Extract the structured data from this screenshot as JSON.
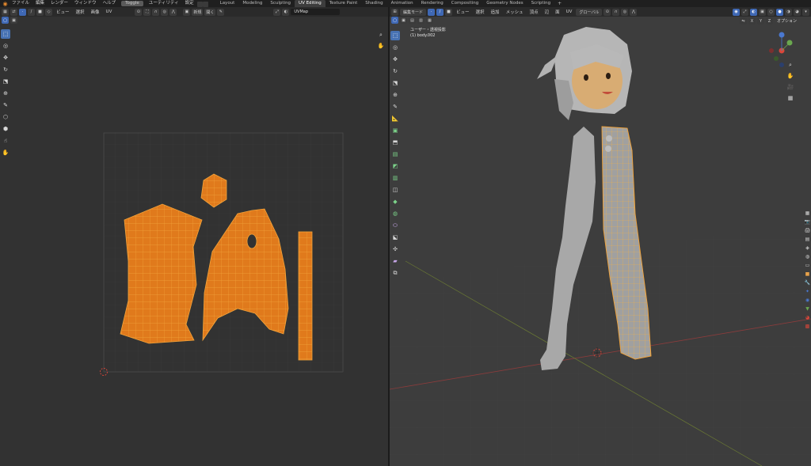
{
  "topbar": {
    "menus": [
      "ファイル",
      "編集",
      "レンダー",
      "ウィンドウ",
      "ヘルプ"
    ],
    "toggle_label": "Toggle",
    "menus2": [
      "ユーティリティ",
      "設定"
    ],
    "workspaces": [
      "Layout",
      "Modeling",
      "Sculpting",
      "UV Editing",
      "Texture Paint",
      "Shading",
      "Animation",
      "Rendering",
      "Compositing",
      "Geometry Nodes",
      "Scripting"
    ],
    "active_workspace": "UV Editing",
    "add_tab": "+"
  },
  "uv_editor": {
    "header_menus": [
      "ビュー",
      "選択",
      "画像",
      "UV"
    ],
    "new_label": "新規",
    "open_label": "開く",
    "uvmap_field": "UVMap"
  },
  "viewport": {
    "mode_label": "編集モード",
    "header_menus": [
      "ビュー",
      "選択",
      "追加",
      "メッシュ",
      "頂点",
      "辺",
      "面",
      "UV"
    ],
    "transform_label": "グローバル",
    "view_name": "ユーザー・透視投影",
    "object_name": "(1) body.002",
    "axis_x": "X",
    "axis_y": "Y",
    "axis_z": "Z",
    "options_label": "オプション"
  },
  "colors": {
    "accent_blue": "#4772b3",
    "uv_orange": "#e07a1c",
    "wire_orange": "#f2a33a",
    "grid_line": "#3b3b3b"
  }
}
